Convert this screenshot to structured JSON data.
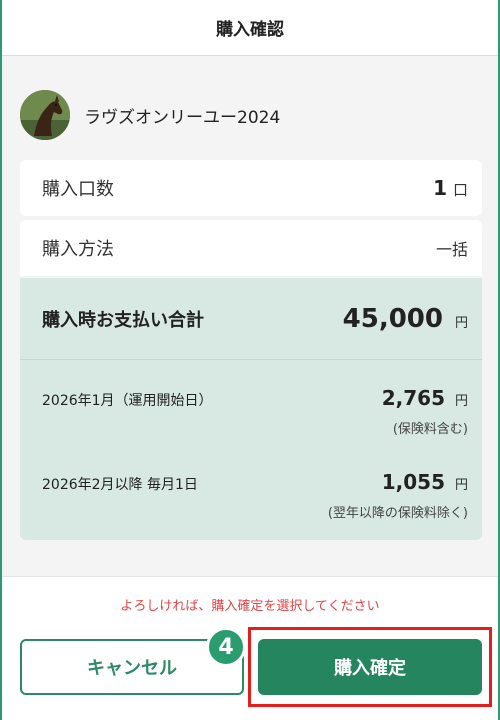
{
  "header": {
    "title": "購入確認"
  },
  "horse": {
    "name": "ラヴズオンリーユー2024",
    "avatar_icon": "horse-photo"
  },
  "quantity": {
    "label": "購入口数",
    "value": "1",
    "unit": "口"
  },
  "method": {
    "label": "購入方法",
    "value": "一括"
  },
  "total": {
    "label": "購入時お支払い合計",
    "amount": "45,000",
    "unit": "円"
  },
  "breakdown": [
    {
      "label": "2026年1月（運用開始日）",
      "amount": "2,765",
      "unit": "円",
      "note": "(保険料含む)"
    },
    {
      "label": "2026年2月以降 毎月1日",
      "amount": "1,055",
      "unit": "円",
      "note": "(翌年以降の保険料除く)"
    }
  ],
  "footer": {
    "message": "よろしければ、購入確定を選択してください",
    "cancel_label": "キャンセル",
    "confirm_label": "購入確定",
    "step_number": "4"
  },
  "colors": {
    "accent": "#24855f",
    "summary_bg": "#d8e8e3",
    "message": "#e04545",
    "highlight": "#e41d1d"
  }
}
